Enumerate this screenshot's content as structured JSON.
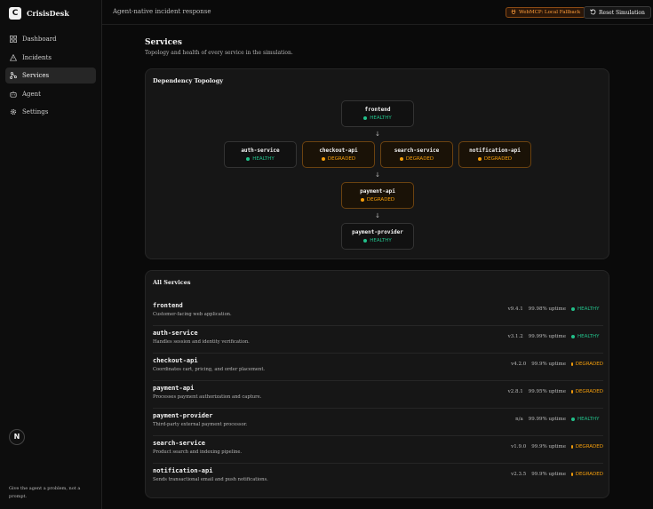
{
  "app": {
    "brand_name": "CrisisDesk",
    "logo_letter": "C",
    "tagline": "Give the agent a problem, not a prompt.",
    "n_badge": "N"
  },
  "sidebar": {
    "items": [
      {
        "label": "Dashboard",
        "icon": "dashboard-icon",
        "active": false
      },
      {
        "label": "Incidents",
        "icon": "alert-triangle-icon",
        "active": false
      },
      {
        "label": "Services",
        "icon": "network-icon",
        "active": true
      },
      {
        "label": "Agent",
        "icon": "bot-icon",
        "active": false
      },
      {
        "label": "Settings",
        "icon": "gear-icon",
        "active": false
      }
    ]
  },
  "header": {
    "title": "Agent-native incident response",
    "webmcp_label": "WebMCP: Local Fallback",
    "reset_label": "Reset Simulation"
  },
  "page": {
    "title": "Services",
    "subtitle": "Topology and health of every service in the simulation."
  },
  "topology": {
    "title": "Dependency Topology",
    "nodes": [
      {
        "name": "frontend",
        "status": "HEALTHY"
      },
      {
        "name": "auth-service",
        "status": "HEALTHY"
      },
      {
        "name": "checkout-api",
        "status": "DEGRADED"
      },
      {
        "name": "search-service",
        "status": "DEGRADED"
      },
      {
        "name": "notification-api",
        "status": "DEGRADED"
      },
      {
        "name": "payment-api",
        "status": "DEGRADED"
      },
      {
        "name": "payment-provider",
        "status": "HEALTHY"
      }
    ]
  },
  "services": {
    "title": "All Services",
    "rows": [
      {
        "name": "frontend",
        "description": "Customer-facing web application.",
        "version": "v9.4.1",
        "uptime": "99.98% uptime",
        "status": "HEALTHY"
      },
      {
        "name": "auth-service",
        "description": "Handles session and identity verification.",
        "version": "v3.1.2",
        "uptime": "99.99% uptime",
        "status": "HEALTHY"
      },
      {
        "name": "checkout-api",
        "description": "Coordinates cart, pricing, and order placement.",
        "version": "v4.2.0",
        "uptime": "99.9% uptime",
        "status": "DEGRADED"
      },
      {
        "name": "payment-api",
        "description": "Processes payment authorization and capture.",
        "version": "v2.8.1",
        "uptime": "99.95% uptime",
        "status": "DEGRADED"
      },
      {
        "name": "payment-provider",
        "description": "Third-party external payment processor.",
        "version": "n/a",
        "uptime": "99.99% uptime",
        "status": "HEALTHY"
      },
      {
        "name": "search-service",
        "description": "Product search and indexing pipeline.",
        "version": "v1.9.0",
        "uptime": "99.9% uptime",
        "status": "DEGRADED"
      },
      {
        "name": "notification-api",
        "description": "Sends transactional email and push notifications.",
        "version": "v2.3.5",
        "uptime": "99.9% uptime",
        "status": "DEGRADED"
      }
    ]
  },
  "colors": {
    "healthy": "#22c08a",
    "degraded": "#f59e0b",
    "webmcp": "#ff9d3a"
  }
}
